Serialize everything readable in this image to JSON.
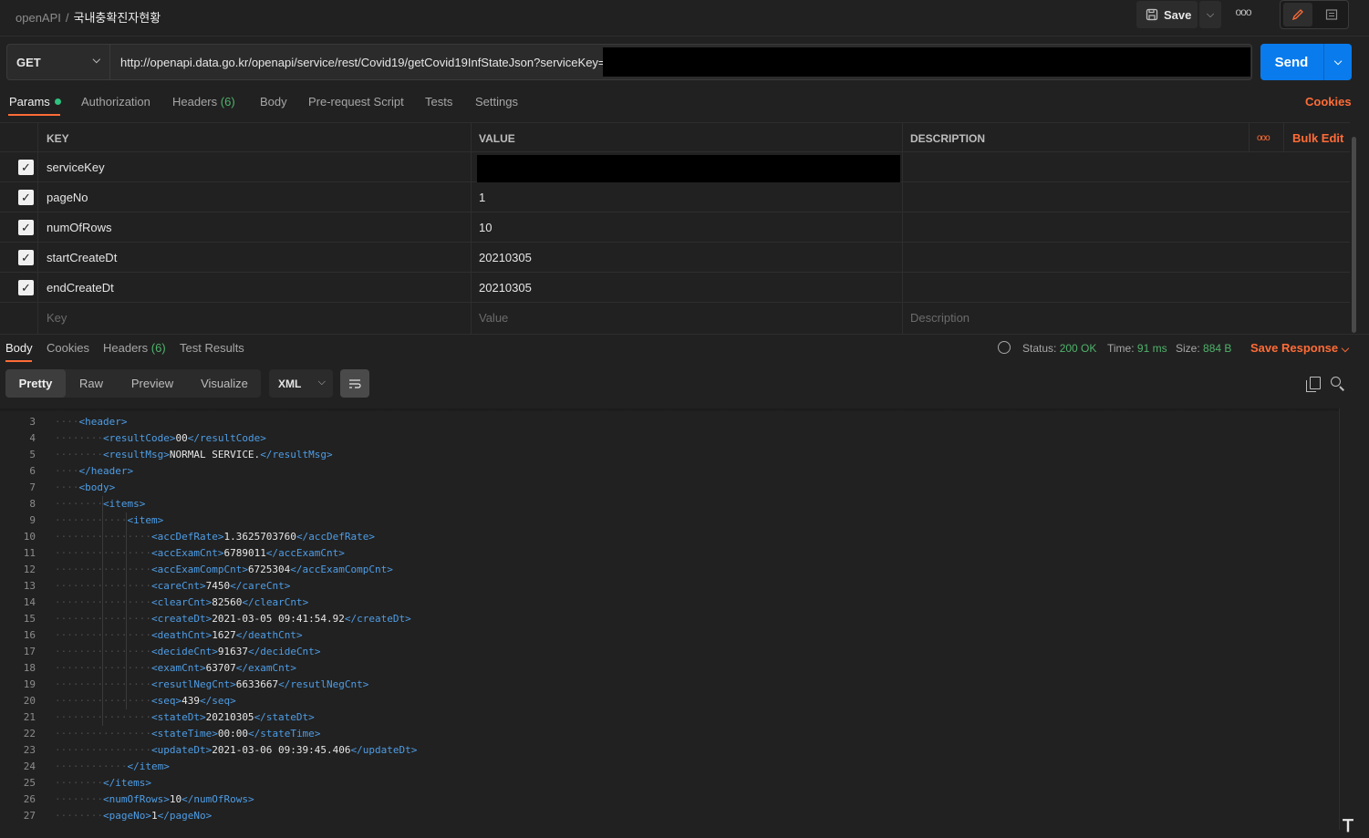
{
  "breadcrumb": {
    "root": "openAPI",
    "separator": "/",
    "current": "국내충확진자현황"
  },
  "toolbar": {
    "save_label": "Save",
    "more": "ooo"
  },
  "request": {
    "method": "GET",
    "url": "http://openapi.data.go.kr/openapi/service/rest/Covid19/getCovid19InfStateJson?serviceKey=",
    "send_label": "Send"
  },
  "req_tabs": {
    "params": "Params",
    "authorization": "Authorization",
    "headers": "Headers",
    "headers_count": "(6)",
    "body": "Body",
    "prerequest": "Pre-request Script",
    "tests": "Tests",
    "settings": "Settings",
    "cookies": "Cookies"
  },
  "params_table": {
    "headers": {
      "key": "KEY",
      "value": "VALUE",
      "description": "DESCRIPTION",
      "bulk_edit": "Bulk Edit",
      "more": "ooo"
    },
    "rows": [
      {
        "key": "serviceKey",
        "value": "",
        "checked": true,
        "redacted": true
      },
      {
        "key": "pageNo",
        "value": "1",
        "checked": true
      },
      {
        "key": "numOfRows",
        "value": "10",
        "checked": true
      },
      {
        "key": "startCreateDt",
        "value": "20210305",
        "checked": true
      },
      {
        "key": "endCreateDt",
        "value": "20210305",
        "checked": true
      }
    ],
    "placeholders": {
      "key": "Key",
      "value": "Value",
      "description": "Description"
    }
  },
  "resp_tabs": {
    "body": "Body",
    "cookies": "Cookies",
    "headers": "Headers",
    "headers_count": "(6)",
    "test_results": "Test Results"
  },
  "response_meta": {
    "status_label": "Status:",
    "status": "200 OK",
    "time_label": "Time:",
    "time": "91 ms",
    "size_label": "Size:",
    "size": "884 B",
    "save_response": "Save Response"
  },
  "format": {
    "pretty": "Pretty",
    "raw": "Raw",
    "preview": "Preview",
    "visualize": "Visualize",
    "language": "XML"
  },
  "code_lines": [
    {
      "n": "3",
      "depth": 1,
      "open": "header",
      "text": "",
      "close": "",
      "mode": "open"
    },
    {
      "n": "4",
      "depth": 2,
      "open": "resultCode",
      "text": "00",
      "close": "resultCode",
      "mode": "leaf"
    },
    {
      "n": "5",
      "depth": 2,
      "open": "resultMsg",
      "text": "NORMAL SERVICE.",
      "close": "resultMsg",
      "mode": "leaf"
    },
    {
      "n": "6",
      "depth": 1,
      "open": "",
      "text": "",
      "close": "header",
      "mode": "close"
    },
    {
      "n": "7",
      "depth": 1,
      "open": "body",
      "text": "",
      "close": "",
      "mode": "open"
    },
    {
      "n": "8",
      "depth": 2,
      "open": "items",
      "text": "",
      "close": "",
      "mode": "open"
    },
    {
      "n": "9",
      "depth": 3,
      "open": "item",
      "text": "",
      "close": "",
      "mode": "open"
    },
    {
      "n": "10",
      "depth": 4,
      "open": "accDefRate",
      "text": "1.3625703760",
      "close": "accDefRate",
      "mode": "leaf"
    },
    {
      "n": "11",
      "depth": 4,
      "open": "accExamCnt",
      "text": "6789011",
      "close": "accExamCnt",
      "mode": "leaf"
    },
    {
      "n": "12",
      "depth": 4,
      "open": "accExamCompCnt",
      "text": "6725304",
      "close": "accExamCompCnt",
      "mode": "leaf"
    },
    {
      "n": "13",
      "depth": 4,
      "open": "careCnt",
      "text": "7450",
      "close": "careCnt",
      "mode": "leaf"
    },
    {
      "n": "14",
      "depth": 4,
      "open": "clearCnt",
      "text": "82560",
      "close": "clearCnt",
      "mode": "leaf"
    },
    {
      "n": "15",
      "depth": 4,
      "open": "createDt",
      "text": "2021-03-05 09:41:54.92",
      "close": "createDt",
      "mode": "leaf"
    },
    {
      "n": "16",
      "depth": 4,
      "open": "deathCnt",
      "text": "1627",
      "close": "deathCnt",
      "mode": "leaf"
    },
    {
      "n": "17",
      "depth": 4,
      "open": "decideCnt",
      "text": "91637",
      "close": "decideCnt",
      "mode": "leaf"
    },
    {
      "n": "18",
      "depth": 4,
      "open": "examCnt",
      "text": "63707",
      "close": "examCnt",
      "mode": "leaf"
    },
    {
      "n": "19",
      "depth": 4,
      "open": "resutlNegCnt",
      "text": "6633667",
      "close": "resutlNegCnt",
      "mode": "leaf"
    },
    {
      "n": "20",
      "depth": 4,
      "open": "seq",
      "text": "439",
      "close": "seq",
      "mode": "leaf"
    },
    {
      "n": "21",
      "depth": 4,
      "open": "stateDt",
      "text": "20210305",
      "close": "stateDt",
      "mode": "leaf"
    },
    {
      "n": "22",
      "depth": 4,
      "open": "stateTime",
      "text": "00:00",
      "close": "stateTime",
      "mode": "leaf"
    },
    {
      "n": "23",
      "depth": 4,
      "open": "updateDt",
      "text": "2021-03-06 09:39:45.406",
      "close": "updateDt",
      "mode": "leaf"
    },
    {
      "n": "24",
      "depth": 3,
      "open": "",
      "text": "",
      "close": "item",
      "mode": "close"
    },
    {
      "n": "25",
      "depth": 2,
      "open": "",
      "text": "",
      "close": "items",
      "mode": "close"
    },
    {
      "n": "26",
      "depth": 2,
      "open": "numOfRows",
      "text": "10",
      "close": "numOfRows",
      "mode": "leaf"
    },
    {
      "n": "27",
      "depth": 2,
      "open": "pageNo",
      "text": "1",
      "close": "pageNo",
      "mode": "leaf"
    }
  ],
  "colors": {
    "accent": "#ff6c37",
    "send": "#097bed",
    "tag": "#4e9de6",
    "success": "#4fb36b"
  }
}
